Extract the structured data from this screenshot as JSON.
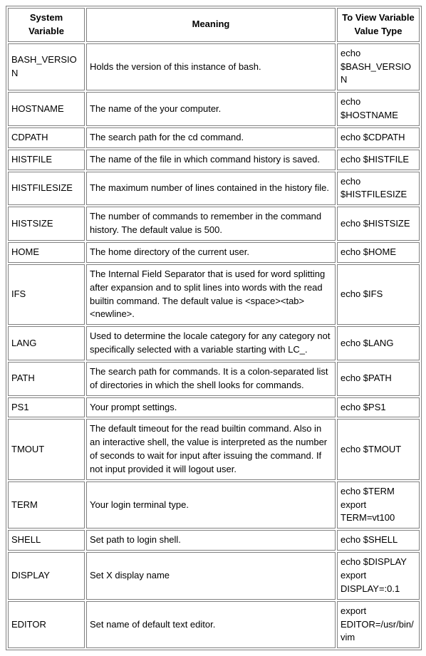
{
  "headers": {
    "var": "System Variable",
    "meaning": "Meaning",
    "view": "To View Variable Value Type"
  },
  "rows": [
    {
      "var": "BASH_VERSION",
      "meaning": "Holds the version of this instance of bash.",
      "view": "echo $BASH_VERSION"
    },
    {
      "var": "HOSTNAME",
      "meaning": "The name of the your computer.",
      "view": "echo $HOSTNAME"
    },
    {
      "var": "CDPATH",
      "meaning": "The search path for the cd command.",
      "view": "echo $CDPATH"
    },
    {
      "var": "HISTFILE",
      "meaning": "The name of the file in which command history is saved.",
      "view": "echo $HISTFILE"
    },
    {
      "var": "HISTFILESIZE",
      "meaning": "The maximum number of lines contained in the history file.",
      "view": "echo $HISTFILESIZE"
    },
    {
      "var": "HISTSIZE",
      "meaning": "The number of commands to remember in the command history. The default value is 500.",
      "view": "echo $HISTSIZE"
    },
    {
      "var": "HOME",
      "meaning": "The home directory of the current user.",
      "view": "echo $HOME"
    },
    {
      "var": "IFS",
      "meaning": "The Internal Field Separator that is used for word splitting after expansion and to split lines into words with the read builtin command. The default value is <space><tab><newline>.",
      "view": "echo $IFS"
    },
    {
      "var": "LANG",
      "meaning": "Used to determine the locale category for any category not specifically selected with a variable starting with LC_.",
      "view": "echo $LANG"
    },
    {
      "var": "PATH",
      "meaning": "The search path for commands. It is a colon-separated list of directories in which the shell looks for commands.",
      "view": "echo $PATH"
    },
    {
      "var": "PS1",
      "meaning": "Your prompt settings.",
      "view": "echo $PS1"
    },
    {
      "var": "TMOUT",
      "meaning": "The default timeout for the read builtin command. Also in an interactive shell, the value is interpreted as the number of seconds to wait for input after issuing the command. If not input provided it will logout user.",
      "view": "echo $TMOUT"
    },
    {
      "var": "TERM",
      "meaning": "Your login terminal type.",
      "view": "echo $TERM\nexport TERM=vt100"
    },
    {
      "var": "SHELL",
      "meaning": "Set path to login shell.",
      "view": "echo $SHELL"
    },
    {
      "var": "DISPLAY",
      "meaning": "Set X display name",
      "view": "echo $DISPLAY\nexport DISPLAY=:0.1"
    },
    {
      "var": "EDITOR",
      "meaning": "Set name of default text editor.",
      "view": "export EDITOR=/usr/bin/vim"
    }
  ]
}
